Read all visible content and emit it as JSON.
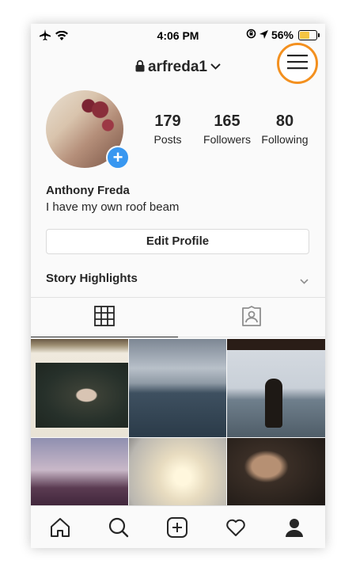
{
  "status_bar": {
    "time": "4:06 PM",
    "battery": "56%",
    "battery_level": 0.56
  },
  "header": {
    "username": "arfreda1",
    "icons": [
      "lock-icon",
      "chevron-down-icon",
      "hamburger-menu-icon"
    ]
  },
  "profile": {
    "stats": [
      {
        "value": "179",
        "label": "Posts"
      },
      {
        "value": "165",
        "label": "Followers"
      },
      {
        "value": "80",
        "label": "Following"
      }
    ],
    "name": "Anthony Freda",
    "bio": "I have my own roof beam",
    "edit_button": "Edit Profile"
  },
  "highlights": {
    "label": "Story Highlights"
  },
  "tabs": [
    "grid-icon",
    "tagged-icon"
  ],
  "bottom_nav": [
    "home-icon",
    "search-icon",
    "add-post-icon",
    "activity-heart-icon",
    "profile-icon"
  ],
  "colors": {
    "accent_orange": "#f3901f",
    "add_badge_blue": "#3897f0"
  }
}
